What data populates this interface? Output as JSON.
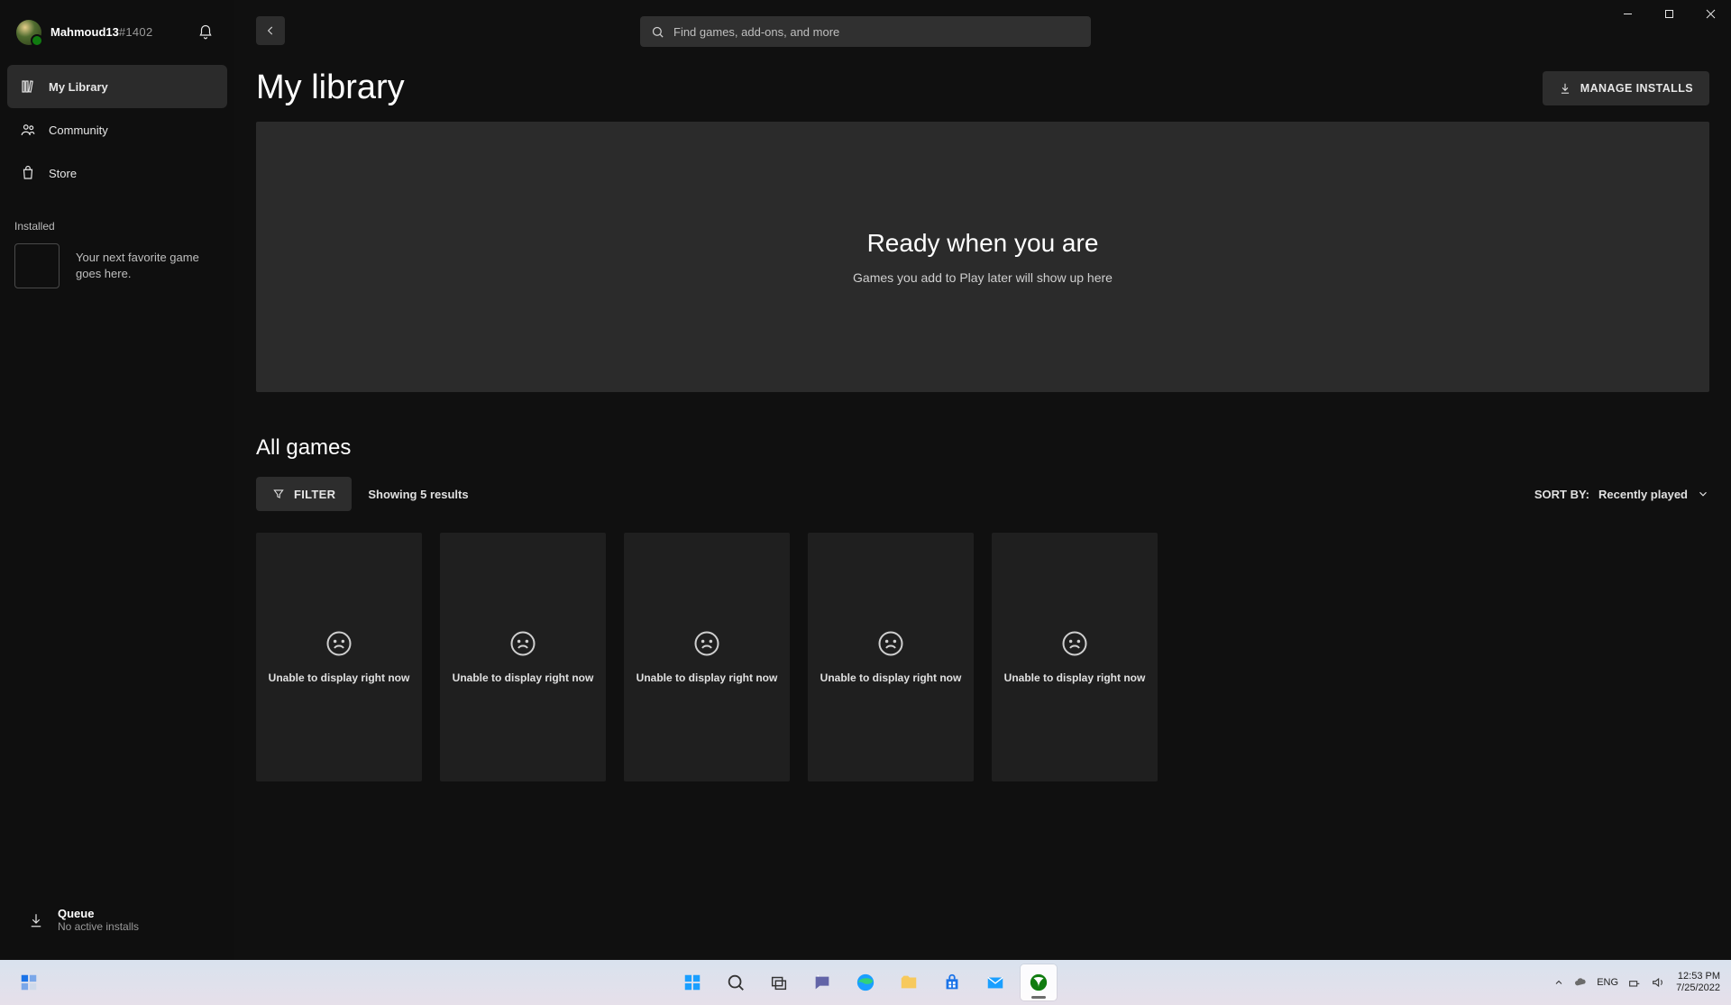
{
  "profile": {
    "gamertag": "Mahmoud13",
    "suffix": "#1402"
  },
  "sidebar": {
    "items": [
      {
        "label": "My Library",
        "icon": "library-icon",
        "active": true
      },
      {
        "label": "Community",
        "icon": "community-icon",
        "active": false
      },
      {
        "label": "Store",
        "icon": "store-icon",
        "active": false
      }
    ],
    "installed_label": "Installed",
    "installed_placeholder_text": "Your next favorite game goes here."
  },
  "queue": {
    "title": "Queue",
    "subtitle": "No active installs"
  },
  "search": {
    "placeholder": "Find games, add-ons, and more"
  },
  "header": {
    "title": "My library",
    "manage_button": "MANAGE INSTALLS"
  },
  "hero": {
    "title": "Ready when you are",
    "subtitle": "Games you add to Play later will show up here"
  },
  "all_games": {
    "section_title": "All games",
    "filter_label": "FILTER",
    "results_text": "Showing 5 results",
    "sort_prefix": "SORT BY:",
    "sort_value": "Recently played",
    "cards": [
      {
        "message": "Unable to display right now"
      },
      {
        "message": "Unable to display right now"
      },
      {
        "message": "Unable to display right now"
      },
      {
        "message": "Unable to display right now"
      },
      {
        "message": "Unable to display right now"
      }
    ]
  },
  "taskbar": {
    "language": "ENG",
    "time": "12:53 PM",
    "date": "7/25/2022"
  }
}
